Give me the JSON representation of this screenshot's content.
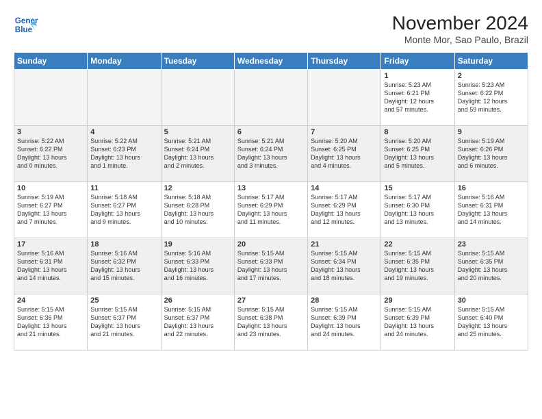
{
  "logo": {
    "line1": "General",
    "line2": "Blue"
  },
  "title": "November 2024",
  "location": "Monte Mor, Sao Paulo, Brazil",
  "weekdays": [
    "Sunday",
    "Monday",
    "Tuesday",
    "Wednesday",
    "Thursday",
    "Friday",
    "Saturday"
  ],
  "weeks": [
    [
      {
        "day": "",
        "info": ""
      },
      {
        "day": "",
        "info": ""
      },
      {
        "day": "",
        "info": ""
      },
      {
        "day": "",
        "info": ""
      },
      {
        "day": "",
        "info": ""
      },
      {
        "day": "1",
        "info": "Sunrise: 5:23 AM\nSunset: 6:21 PM\nDaylight: 12 hours\nand 57 minutes."
      },
      {
        "day": "2",
        "info": "Sunrise: 5:23 AM\nSunset: 6:22 PM\nDaylight: 12 hours\nand 59 minutes."
      }
    ],
    [
      {
        "day": "3",
        "info": "Sunrise: 5:22 AM\nSunset: 6:22 PM\nDaylight: 13 hours\nand 0 minutes."
      },
      {
        "day": "4",
        "info": "Sunrise: 5:22 AM\nSunset: 6:23 PM\nDaylight: 13 hours\nand 1 minute."
      },
      {
        "day": "5",
        "info": "Sunrise: 5:21 AM\nSunset: 6:24 PM\nDaylight: 13 hours\nand 2 minutes."
      },
      {
        "day": "6",
        "info": "Sunrise: 5:21 AM\nSunset: 6:24 PM\nDaylight: 13 hours\nand 3 minutes."
      },
      {
        "day": "7",
        "info": "Sunrise: 5:20 AM\nSunset: 6:25 PM\nDaylight: 13 hours\nand 4 minutes."
      },
      {
        "day": "8",
        "info": "Sunrise: 5:20 AM\nSunset: 6:25 PM\nDaylight: 13 hours\nand 5 minutes."
      },
      {
        "day": "9",
        "info": "Sunrise: 5:19 AM\nSunset: 6:26 PM\nDaylight: 13 hours\nand 6 minutes."
      }
    ],
    [
      {
        "day": "10",
        "info": "Sunrise: 5:19 AM\nSunset: 6:27 PM\nDaylight: 13 hours\nand 7 minutes."
      },
      {
        "day": "11",
        "info": "Sunrise: 5:18 AM\nSunset: 6:27 PM\nDaylight: 13 hours\nand 9 minutes."
      },
      {
        "day": "12",
        "info": "Sunrise: 5:18 AM\nSunset: 6:28 PM\nDaylight: 13 hours\nand 10 minutes."
      },
      {
        "day": "13",
        "info": "Sunrise: 5:17 AM\nSunset: 6:29 PM\nDaylight: 13 hours\nand 11 minutes."
      },
      {
        "day": "14",
        "info": "Sunrise: 5:17 AM\nSunset: 6:29 PM\nDaylight: 13 hours\nand 12 minutes."
      },
      {
        "day": "15",
        "info": "Sunrise: 5:17 AM\nSunset: 6:30 PM\nDaylight: 13 hours\nand 13 minutes."
      },
      {
        "day": "16",
        "info": "Sunrise: 5:16 AM\nSunset: 6:31 PM\nDaylight: 13 hours\nand 14 minutes."
      }
    ],
    [
      {
        "day": "17",
        "info": "Sunrise: 5:16 AM\nSunset: 6:31 PM\nDaylight: 13 hours\nand 14 minutes."
      },
      {
        "day": "18",
        "info": "Sunrise: 5:16 AM\nSunset: 6:32 PM\nDaylight: 13 hours\nand 15 minutes."
      },
      {
        "day": "19",
        "info": "Sunrise: 5:16 AM\nSunset: 6:33 PM\nDaylight: 13 hours\nand 16 minutes."
      },
      {
        "day": "20",
        "info": "Sunrise: 5:15 AM\nSunset: 6:33 PM\nDaylight: 13 hours\nand 17 minutes."
      },
      {
        "day": "21",
        "info": "Sunrise: 5:15 AM\nSunset: 6:34 PM\nDaylight: 13 hours\nand 18 minutes."
      },
      {
        "day": "22",
        "info": "Sunrise: 5:15 AM\nSunset: 6:35 PM\nDaylight: 13 hours\nand 19 minutes."
      },
      {
        "day": "23",
        "info": "Sunrise: 5:15 AM\nSunset: 6:35 PM\nDaylight: 13 hours\nand 20 minutes."
      }
    ],
    [
      {
        "day": "24",
        "info": "Sunrise: 5:15 AM\nSunset: 6:36 PM\nDaylight: 13 hours\nand 21 minutes."
      },
      {
        "day": "25",
        "info": "Sunrise: 5:15 AM\nSunset: 6:37 PM\nDaylight: 13 hours\nand 21 minutes."
      },
      {
        "day": "26",
        "info": "Sunrise: 5:15 AM\nSunset: 6:37 PM\nDaylight: 13 hours\nand 22 minutes."
      },
      {
        "day": "27",
        "info": "Sunrise: 5:15 AM\nSunset: 6:38 PM\nDaylight: 13 hours\nand 23 minutes."
      },
      {
        "day": "28",
        "info": "Sunrise: 5:15 AM\nSunset: 6:39 PM\nDaylight: 13 hours\nand 24 minutes."
      },
      {
        "day": "29",
        "info": "Sunrise: 5:15 AM\nSunset: 6:39 PM\nDaylight: 13 hours\nand 24 minutes."
      },
      {
        "day": "30",
        "info": "Sunrise: 5:15 AM\nSunset: 6:40 PM\nDaylight: 13 hours\nand 25 minutes."
      }
    ]
  ]
}
